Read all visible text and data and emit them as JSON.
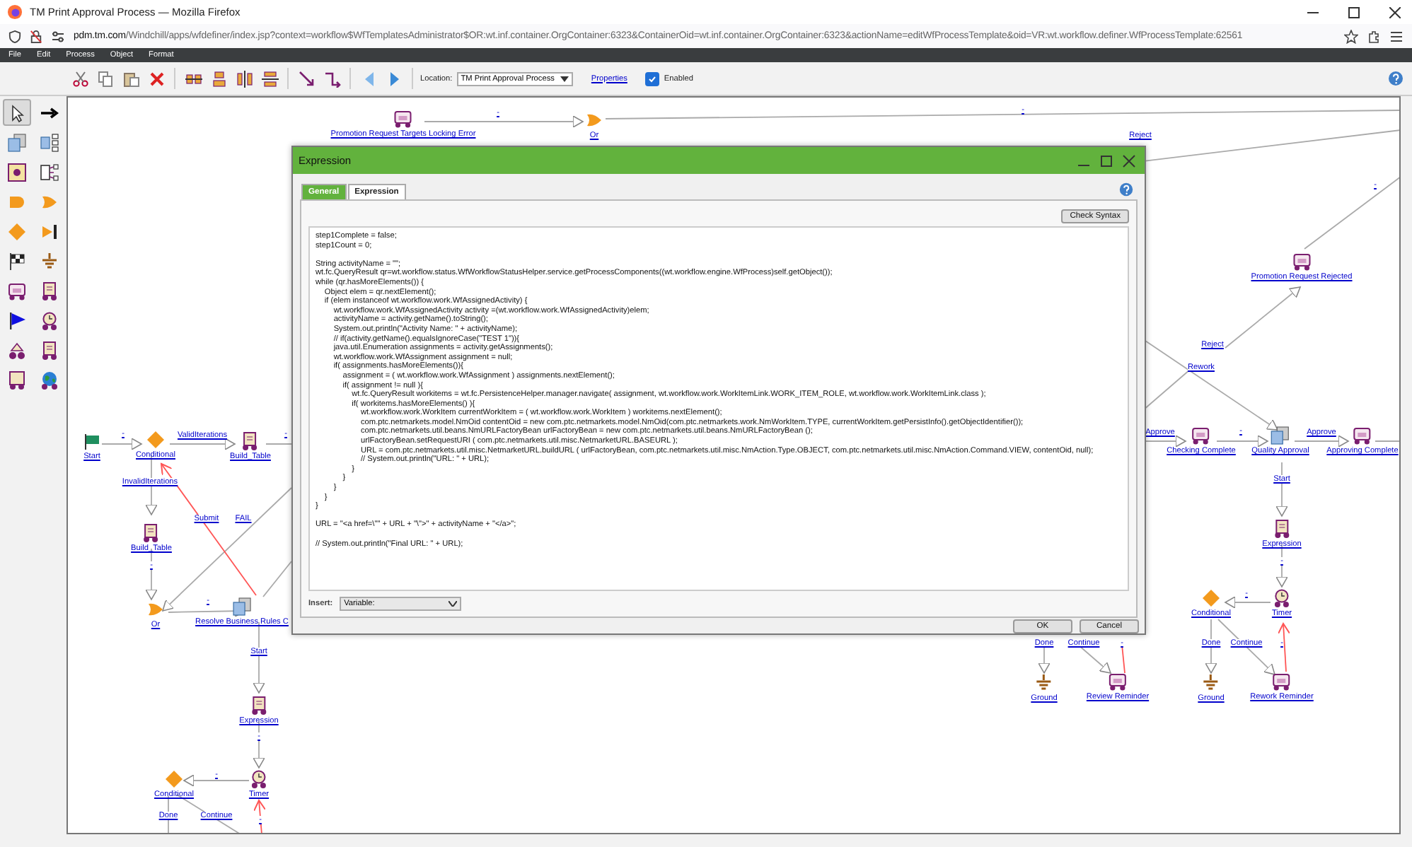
{
  "browser": {
    "title": "TM Print Approval Process — Mozilla Firefox",
    "url_host": "pdm.tm.com",
    "url_path": "/Windchill/apps/wfdefiner/index.jsp?context=workflow$WfTemplatesAdministrator$OR:wt.inf.container.OrgContainer:6323&ContainerOid=wt.inf.container.OrgContainer:6323&actionName=editWfProcessTemplate&oid=VR:wt.workflow.definer.WfProcessTemplate:62561"
  },
  "menu": [
    "File",
    "Edit",
    "Process",
    "Object",
    "Format"
  ],
  "toolbar": {
    "location_label": "Location:",
    "location_value": "TM Print Approval Process",
    "properties_link": "Properties",
    "enabled": {
      "label": "Enabled",
      "checked": true
    }
  },
  "palette": [
    {
      "kind": "pointer",
      "selected": true
    },
    {
      "kind": "arrow",
      "selected": false
    },
    {
      "kind": "task",
      "selected": false
    },
    {
      "kind": "subprocess",
      "selected": false
    },
    {
      "kind": "proxy",
      "selected": false
    },
    {
      "kind": "tree",
      "selected": false
    },
    {
      "kind": "and",
      "selected": false
    },
    {
      "kind": "or",
      "selected": false
    },
    {
      "kind": "conditional",
      "selected": false
    },
    {
      "kind": "synch",
      "selected": false
    },
    {
      "kind": "end",
      "selected": false
    },
    {
      "kind": "ground",
      "selected": false
    },
    {
      "kind": "notification",
      "selected": false
    },
    {
      "kind": "activity",
      "selected": false
    },
    {
      "kind": "bluestart",
      "selected": false
    },
    {
      "kind": "timer",
      "selected": false
    },
    {
      "kind": "group",
      "selected": false
    },
    {
      "kind": "activity",
      "selected": false
    },
    {
      "kind": "assigned",
      "selected": false
    },
    {
      "kind": "globe",
      "selected": false
    }
  ],
  "diagram": {
    "nodes": [
      {
        "kind": "notification",
        "label": "Promotion Request Targets Locking Error"
      },
      {
        "kind": "or",
        "label": "Or"
      },
      {
        "kind": "notification",
        "label": "Promotion Request Rejected"
      },
      {
        "kind": "notification",
        "label": "Checking Complete"
      },
      {
        "kind": "task",
        "label": "Quality Approval"
      },
      {
        "kind": "notification",
        "label": "Approving Complete"
      },
      {
        "kind": "activity",
        "label": "Expression"
      },
      {
        "kind": "conditional",
        "label": "Conditional"
      },
      {
        "kind": "timer",
        "label": "Timer"
      },
      {
        "kind": "ground",
        "label": "Ground"
      },
      {
        "kind": "notification",
        "label": "Review Reminder"
      },
      {
        "kind": "ground",
        "label": "Ground"
      },
      {
        "kind": "notification",
        "label": "Rework Reminder"
      },
      {
        "kind": "start",
        "label": "Start"
      },
      {
        "kind": "conditional",
        "label": "Conditional"
      },
      {
        "kind": "activity",
        "label": "Build_Table"
      },
      {
        "kind": "activity",
        "label": "Build_Table"
      },
      {
        "kind": "or",
        "label": "Or"
      },
      {
        "kind": "task",
        "label": "Resolve Business Rules C"
      },
      {
        "kind": "activity",
        "label": "Expression"
      },
      {
        "kind": "conditional",
        "label": "Conditional"
      },
      {
        "kind": "timer",
        "label": "Timer"
      }
    ],
    "edge_labels": [
      "-",
      "-",
      "Reject",
      "-",
      "Reject",
      "Rework",
      "Approve",
      "-",
      "Approve",
      "Start",
      "-",
      "-",
      "Done",
      "Continue",
      "-",
      "Done",
      "Continue",
      "-",
      "-",
      "ValidIterations",
      "-",
      "InvalidIterations",
      "Submit",
      "FAIL",
      "-",
      "-",
      "Start",
      "-",
      "-",
      "Done",
      "Continue",
      "-"
    ]
  },
  "dialog": {
    "title": "Expression",
    "tabs": [
      {
        "label": "General",
        "selected": false
      },
      {
        "label": "Expression",
        "selected": true
      }
    ],
    "check_syntax": "Check Syntax",
    "code_blocks": [
      [
        "step1Complete = false;",
        "step1Count = 0;"
      ],
      [
        "String activityName = \"\";",
        "wt.fc.QueryResult qr=wt.workflow.status.WfWorkflowStatusHelper.service.getProcessComponents((wt.workflow.engine.WfProcess)self.getObject());",
        "while (qr.hasMoreElements()) {",
        "\tObject elem = qr.nextElement();",
        "\tif (elem instanceof wt.workflow.work.WfAssignedActivity) {",
        "\t\twt.workflow.work.WfAssignedActivity activity =(wt.workflow.work.WfAssignedActivity)elem;",
        "\t\tactivityName = activity.getName().toString();",
        "\t\tSystem.out.println(\"Activity Name: \" + activityName);",
        "\t\t// if(activity.getName().equalsIgnoreCase(\"TEST 1\")){",
        "\t\tjava.util.Enumeration assignments = activity.getAssignments();",
        "\t\twt.workflow.work.WfAssignment assignment = null;",
        "\t\tif( assignments.hasMoreElements()){",
        "\t\t\tassignment = ( wt.workflow.work.WfAssignment ) assignments.nextElement();",
        "\t\t\tif( assignment != null ){",
        "\t\t\t\twt.fc.QueryResult workitems = wt.fc.PersistenceHelper.manager.navigate( assignment, wt.workflow.work.WorkItemLink.WORK_ITEM_ROLE, wt.workflow.work.WorkItemLink.class );",
        "\t\t\t\tif( workitems.hasMoreElements() ){",
        "\t\t\t\t\twt.workflow.work.WorkItem currentWorkItem = ( wt.workflow.work.WorkItem ) workitems.nextElement();",
        "\t\t\t\t\tcom.ptc.netmarkets.model.NmOid contentOid = new com.ptc.netmarkets.model.NmOid(com.ptc.netmarkets.work.NmWorkItem.TYPE, currentWorkItem.getPersistInfo().getObjectIdentifier());",
        "\t\t\t\t\tcom.ptc.netmarkets.util.beans.NmURLFactoryBean urlFactoryBean = new com.ptc.netmarkets.util.beans.NmURLFactoryBean ();",
        "\t\t\t\t\turlFactoryBean.setRequestURI ( com.ptc.netmarkets.util.misc.NetmarketURL.BASEURL );",
        "\t\t\t\t\tURL = com.ptc.netmarkets.util.misc.NetmarketURL.buildURL ( urlFactoryBean, com.ptc.netmarkets.util.misc.NmAction.Type.OBJECT, com.ptc.netmarkets.util.misc.NmAction.Command.VIEW, contentOid, null);",
        "\t\t\t\t\t// System.out.println(\"URL: \" + URL);",
        "\t\t\t\t}",
        "\t\t\t}",
        "\t\t}",
        "\t}",
        "}"
      ],
      [
        "URL = \"<a href=\\\"\" + URL + \"\\\">\" + activityName + \"</a>\";"
      ],
      [
        "// System.out.println(\"Final URL: \" + URL);"
      ]
    ],
    "insert_label": "Insert:",
    "insert_value": "Variable:",
    "buttons": [
      "OK",
      "Cancel"
    ]
  }
}
